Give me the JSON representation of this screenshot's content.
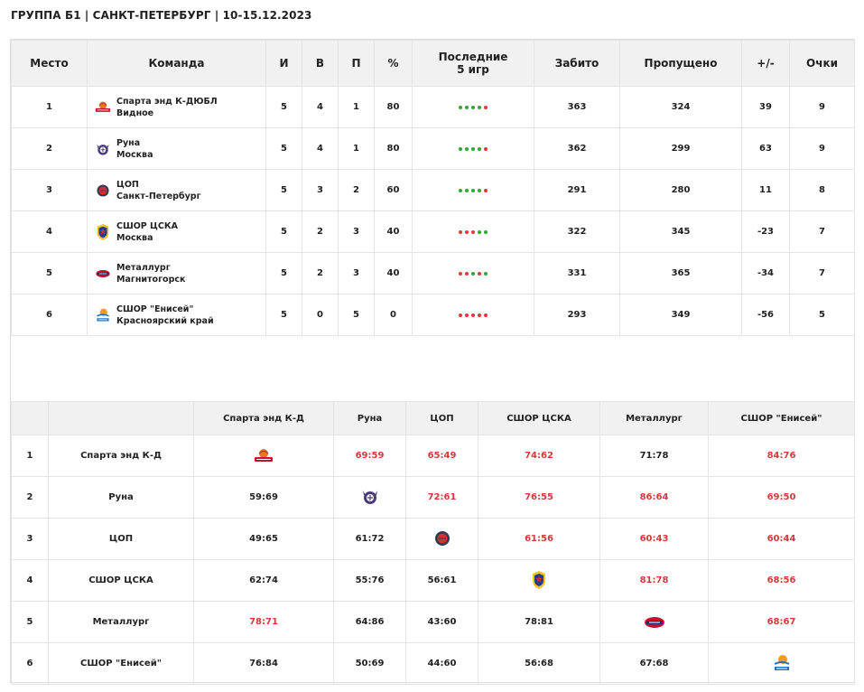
{
  "title": "ГРУППА Б1 | САНКТ-ПЕТЕРБУРГ | 10-15.12.2023",
  "standings": {
    "headers": {
      "place": "Место",
      "team": "Команда",
      "games": "И",
      "wins": "В",
      "losses": "П",
      "percent": "%",
      "last5_line1": "Последние",
      "last5_line2": "5 игр",
      "scored": "Забито",
      "conceded": "Пропущено",
      "diff": "+/-",
      "points": "Очки"
    },
    "rows": [
      {
        "place": "1",
        "team": "Спарта энд К-ДЮБЛ",
        "city": "Видное",
        "logo": "sparta-logo",
        "games": "5",
        "wins": "4",
        "losses": "1",
        "percent": "80",
        "last5": [
          "w",
          "w",
          "w",
          "w",
          "l"
        ],
        "scored": "363",
        "conceded": "324",
        "diff": "39",
        "points": "9"
      },
      {
        "place": "2",
        "team": "Руна",
        "city": "Москва",
        "logo": "runa-logo",
        "games": "5",
        "wins": "4",
        "losses": "1",
        "percent": "80",
        "last5": [
          "w",
          "w",
          "w",
          "w",
          "l"
        ],
        "scored": "362",
        "conceded": "299",
        "diff": "63",
        "points": "9"
      },
      {
        "place": "3",
        "team": "ЦОП",
        "city": "Санкт-Петербург",
        "logo": "cop-logo",
        "games": "5",
        "wins": "3",
        "losses": "2",
        "percent": "60",
        "last5": [
          "w",
          "w",
          "w",
          "w",
          "l"
        ],
        "scored": "291",
        "conceded": "280",
        "diff": "11",
        "points": "8"
      },
      {
        "place": "4",
        "team": "СШОР ЦСКА",
        "city": "Москва",
        "logo": "cska-logo",
        "games": "5",
        "wins": "2",
        "losses": "3",
        "percent": "40",
        "last5": [
          "l",
          "l",
          "l",
          "w",
          "w"
        ],
        "scored": "322",
        "conceded": "345",
        "diff": "-23",
        "points": "7"
      },
      {
        "place": "5",
        "team": "Металлург",
        "city": "Магнитогорск",
        "logo": "metallurg-logo",
        "games": "5",
        "wins": "2",
        "losses": "3",
        "percent": "40",
        "last5": [
          "l",
          "l",
          "w",
          "l",
          "w"
        ],
        "scored": "331",
        "conceded": "365",
        "diff": "-34",
        "points": "7"
      },
      {
        "place": "6",
        "team": "СШОР \"Енисей\"",
        "city": "Красноярский край",
        "logo": "enisey-logo",
        "games": "5",
        "wins": "0",
        "losses": "5",
        "percent": "0",
        "last5": [
          "l",
          "l",
          "l",
          "l",
          "l"
        ],
        "scored": "293",
        "conceded": "349",
        "diff": "-56",
        "points": "5"
      }
    ]
  },
  "cross_table": {
    "headers": [
      "Спарта энд К-Д",
      "Руна",
      "ЦОП",
      "СШОР ЦСКА",
      "Металлург",
      "СШОР \"Енисей\""
    ],
    "rows": [
      {
        "place": "1",
        "team": "Спарта энд К-Д",
        "cells": [
          {
            "diag": "sparta-logo"
          },
          {
            "score": "69:59",
            "win": true
          },
          {
            "score": "65:49",
            "win": true
          },
          {
            "score": "74:62",
            "win": true
          },
          {
            "score": "71:78",
            "win": false
          },
          {
            "score": "84:76",
            "win": true
          }
        ]
      },
      {
        "place": "2",
        "team": "Руна",
        "cells": [
          {
            "score": "59:69",
            "win": false
          },
          {
            "diag": "runa-logo"
          },
          {
            "score": "72:61",
            "win": true
          },
          {
            "score": "76:55",
            "win": true
          },
          {
            "score": "86:64",
            "win": true
          },
          {
            "score": "69:50",
            "win": true
          }
        ]
      },
      {
        "place": "3",
        "team": "ЦОП",
        "cells": [
          {
            "score": "49:65",
            "win": false
          },
          {
            "score": "61:72",
            "win": false
          },
          {
            "diag": "cop-logo"
          },
          {
            "score": "61:56",
            "win": true
          },
          {
            "score": "60:43",
            "win": true
          },
          {
            "score": "60:44",
            "win": true
          }
        ]
      },
      {
        "place": "4",
        "team": "СШОР ЦСКА",
        "cells": [
          {
            "score": "62:74",
            "win": false
          },
          {
            "score": "55:76",
            "win": false
          },
          {
            "score": "56:61",
            "win": false
          },
          {
            "diag": "cska-logo"
          },
          {
            "score": "81:78",
            "win": true
          },
          {
            "score": "68:56",
            "win": true
          }
        ]
      },
      {
        "place": "5",
        "team": "Металлург",
        "cells": [
          {
            "score": "78:71",
            "win": true
          },
          {
            "score": "64:86",
            "win": false
          },
          {
            "score": "43:60",
            "win": false
          },
          {
            "score": "78:81",
            "win": false
          },
          {
            "diag": "metallurg-logo"
          },
          {
            "score": "68:67",
            "win": true
          }
        ]
      },
      {
        "place": "6",
        "team": "СШОР \"Енисей\"",
        "cells": [
          {
            "score": "76:84",
            "win": false
          },
          {
            "score": "50:69",
            "win": false
          },
          {
            "score": "44:60",
            "win": false
          },
          {
            "score": "56:68",
            "win": false
          },
          {
            "score": "67:68",
            "win": false
          },
          {
            "diag": "enisey-logo"
          }
        ]
      }
    ]
  },
  "colors": {
    "win_dot": "#2eaa2e",
    "loss_dot": "#e03a3a",
    "win_score": "#d23b3b",
    "header_bg": "#f1f1f1"
  }
}
